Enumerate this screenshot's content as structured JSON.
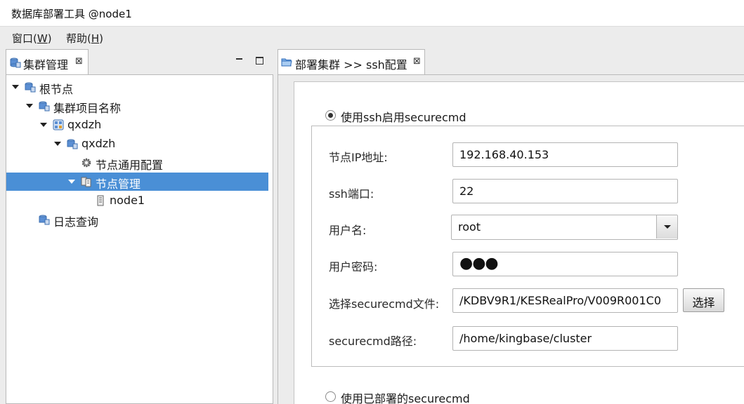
{
  "window": {
    "title": "数据库部署工具 @node1"
  },
  "menu": [
    {
      "label": "窗口(",
      "key": "W",
      "suffix": ")"
    },
    {
      "label": "帮助(",
      "key": "H",
      "suffix": ")"
    }
  ],
  "left_tab": {
    "label": "集群管理",
    "close": "⊠"
  },
  "tree": [
    {
      "label": "根节点",
      "icon": "db-icon"
    },
    {
      "label": "集群项目名称",
      "icon": "db-icon"
    },
    {
      "label": "qxdzh",
      "icon": "cluster-icon"
    },
    {
      "label": "qxdzh",
      "icon": "db-icon"
    },
    {
      "label": "节点通用配置",
      "icon": "gear-icon"
    },
    {
      "label": "节点管理",
      "icon": "nodes-icon",
      "selected": true
    },
    {
      "label": "node1",
      "icon": "server-icon"
    },
    {
      "label": "日志查询",
      "icon": "db-icon"
    }
  ],
  "right_tab": {
    "label": "部署集群 >> ssh配置",
    "close": "⊠"
  },
  "form": {
    "radio_ssh": "使用ssh启用securecmd",
    "radio_deployed": "使用已部署的securecmd",
    "ip_label": "节点IP地址:",
    "ip_value": "192.168.40.153",
    "port_label": "ssh端口:",
    "port_value": "22",
    "user_label": "用户名:",
    "user_value": "root",
    "password_label": "用户密码:",
    "password_value": "●●●",
    "file_label": "选择securecmd文件:",
    "file_value": "/KDBV9R1/KESRealPro/V009R001C0",
    "choose_button": "选择",
    "path_label": "securecmd路径:",
    "path_value": "/home/kingbase/cluster"
  },
  "colors": {
    "selection": "#4a8fd6",
    "db_icon": "#5b8fd4"
  }
}
